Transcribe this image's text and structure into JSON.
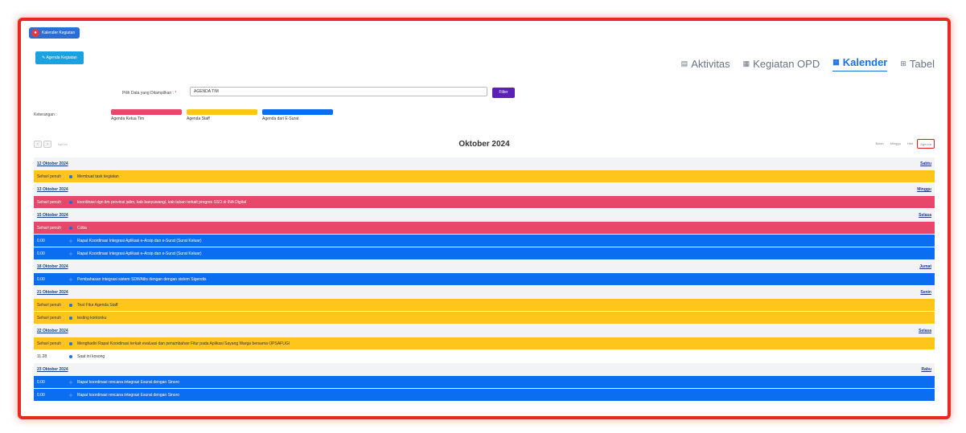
{
  "app": {
    "title": "Kalender Kegiatan",
    "agenda_button": "Agenda Kegiatan"
  },
  "tabs": [
    {
      "icon": "list-icon",
      "label": "Aktivitas",
      "active": false
    },
    {
      "icon": "clipboard-icon",
      "label": "Kegiatan OPD",
      "active": false
    },
    {
      "icon": "calendar-icon",
      "label": "Kalender",
      "active": true
    },
    {
      "icon": "table-icon",
      "label": "Tabel",
      "active": false
    }
  ],
  "filter": {
    "label": "Pilih Data yang Ditampilkan :",
    "required_mark": "*",
    "value": "AGENDA TIM",
    "button": "Filter"
  },
  "legend": {
    "label": "Keterangan :",
    "items": [
      {
        "label": "Agenda Ketua Tim",
        "color": "#e6476a"
      },
      {
        "label": "Agenda Staff",
        "color": "#fec51a"
      },
      {
        "label": "Agenda dari E-Surat",
        "color": "#0b6df0"
      }
    ]
  },
  "calendar": {
    "prev": "‹",
    "next": "›",
    "today": "hari ini",
    "title": "Oktober 2024",
    "views": [
      "Bulan",
      "Minggu",
      "Hari",
      "Agenda"
    ],
    "active_view": "Agenda"
  },
  "days": [
    {
      "date": "12 Oktober 2024",
      "weekday": "Sabtu",
      "events": [
        {
          "time": "Seharí penuh",
          "text": "Membuat task kegiatan",
          "color": "yellow"
        }
      ]
    },
    {
      "date": "13 Oktober 2024",
      "weekday": "Minggu",
      "events": [
        {
          "time": "Seharí penuh",
          "text": "koordinasi dgn tim provinsi jatim, kab banyuwangi, kab tuban terkait progres SSO di INA Digital",
          "color": "pink"
        }
      ]
    },
    {
      "date": "15 Oktober 2024",
      "weekday": "Selasa",
      "events": [
        {
          "time": "Seharí penuh",
          "text": "Coba",
          "color": "pink"
        },
        {
          "time": "0.00",
          "text": "Rapat Koordinasi Integrasi Aplikasi e-Arsip dan e-Surat (Surat Keluar)",
          "color": "blue"
        },
        {
          "time": "0.00",
          "text": "Rapat Koordinasi Integrasi Aplikasi e-Arsip dan e-Surat (Surat Keluar)",
          "color": "blue"
        }
      ]
    },
    {
      "date": "18 Oktober 2024",
      "weekday": "Jumat",
      "events": [
        {
          "time": "0.00",
          "text": "Pembahasan integrasi sistem SDWAtlis dengan dengan sistem Sigendis",
          "color": "blue"
        }
      ]
    },
    {
      "date": "21 Oktober 2024",
      "weekday": "Senin",
      "events": [
        {
          "time": "Seharí penuh",
          "text": "Test Fitur Agenda Staff",
          "color": "yellow"
        },
        {
          "time": "Seharí penuh",
          "text": "testing kontonku",
          "color": "yellow"
        }
      ]
    },
    {
      "date": "22 Oktober 2024",
      "weekday": "Selasa",
      "events": [
        {
          "time": "Seharí penuh",
          "text": "Menghadiri Rapat Koordinasi terkait evaluasi dan penambahan Fitur pada Aplikasi Sayang Warga bersama OPSAFUGI",
          "color": "yellow"
        },
        {
          "time": "11.28",
          "text": "Saat ini kosong",
          "color": "white"
        }
      ]
    },
    {
      "date": "23 Oktober 2024",
      "weekday": "Rabu",
      "events": [
        {
          "time": "0.00",
          "text": "Rapat koordinasi rencana integrasi Esurat dengan Sinoro",
          "color": "blue"
        },
        {
          "time": "0.00",
          "text": "Rapat koordinasi rencana integrasi Esurat dengan Sinoro",
          "color": "blue"
        }
      ]
    }
  ],
  "colors": {
    "frame_highlight": "#e62a22",
    "accent": "#1d6fe0",
    "filter_button": "#5b21b6"
  }
}
